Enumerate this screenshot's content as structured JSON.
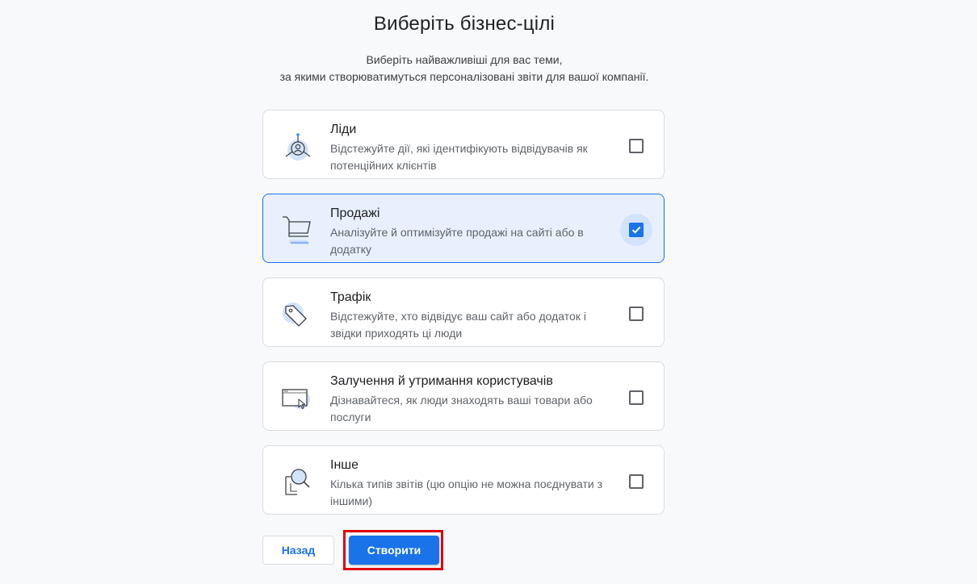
{
  "title": "Виберіть бізнес-цілі",
  "subtitle_line1": "Виберіть найважливіші для вас теми,",
  "subtitle_line2": "за якими створюватимуться персоналізовані звіти для вашої компанії.",
  "options": [
    {
      "title": "Ліди",
      "description": "Відстежуйте дії, які ідентифікують відвідувачів як потенційних клієнтів",
      "checked": false,
      "icon": "leads-icon"
    },
    {
      "title": "Продажі",
      "description": "Аналізуйте й оптимізуйте продажі на сайті або в додатку",
      "checked": true,
      "icon": "shopping-cart-icon"
    },
    {
      "title": "Трафік",
      "description": "Відстежуйте, хто відвідує ваш сайт або додаток і звідки приходять ці люди",
      "checked": false,
      "icon": "tag-icon"
    },
    {
      "title": "Залучення й утримання користувачів",
      "description": "Дізнавайтеся, як люди знаходять ваші товари або послуги",
      "checked": false,
      "icon": "browser-cursor-icon"
    },
    {
      "title": "Інше",
      "description": "Кілька типів звітів (цю опцію не можна поєднувати з іншими)",
      "checked": false,
      "icon": "magnifier-icon"
    }
  ],
  "buttons": {
    "back": "Назад",
    "create": "Створити"
  },
  "colors": {
    "accent": "#1a73e8",
    "selected_bg": "#e8f0fe",
    "highlight": "#e00000"
  }
}
